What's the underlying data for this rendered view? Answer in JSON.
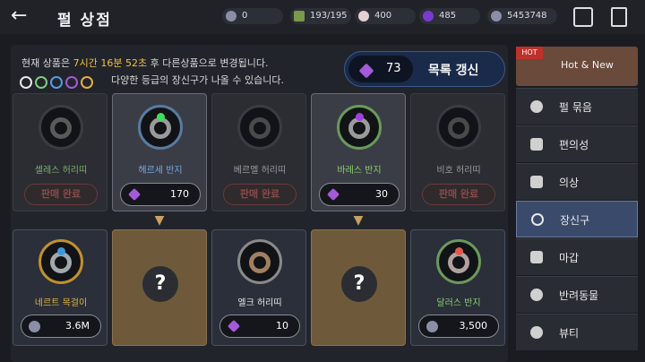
{
  "header": {
    "title": "펄 상점",
    "resources": [
      {
        "value": "0",
        "icon": "silver-coin-icon"
      },
      {
        "value": "193/195",
        "icon": "weight-icon"
      },
      {
        "value": "400",
        "icon": "pearl-icon"
      },
      {
        "value": "485",
        "icon": "gem-icon"
      },
      {
        "value": "5453748",
        "icon": "silver-icon"
      }
    ]
  },
  "notice": {
    "prefix": "현재 상품은",
    "time": "7시간 16분 52초",
    "suffix": "후 다른상품으로 변경됩니다.",
    "grades": "다양한 등급의 장신구가 나올 수 있습니다."
  },
  "refresh": {
    "count": "73",
    "label": "목록 갱신"
  },
  "top_cards": [
    {
      "name": "셀레스 허리띠",
      "name_color": "#7fae6e",
      "status": "판매 완료",
      "selected": false
    },
    {
      "name": "헤르세 반지",
      "name_color": "#7aa6e0",
      "price": "170",
      "selected": true
    },
    {
      "name": "베르멜 허리띠",
      "name_color": "#9a9a9a",
      "status": "판매 완료",
      "selected": false
    },
    {
      "name": "바레스 반지",
      "name_color": "#8ad06a",
      "price": "30",
      "selected": true
    },
    {
      "name": "비호 허리띠",
      "name_color": "#9a9a9a",
      "status": "판매 완료",
      "selected": false
    }
  ],
  "bottom_cards": [
    {
      "name": "네르트 목걸이",
      "name_color": "#e0b040",
      "price": "3.6M",
      "currency": "silver"
    },
    {
      "mystery": "?"
    },
    {
      "name": "엘크 허리띠",
      "name_color": "#e8e8e8",
      "price": "10",
      "currency": "gem"
    },
    {
      "mystery": "?"
    },
    {
      "name": "달러스 반지",
      "name_color": "#8ad06a",
      "price": "3,500",
      "currency": "silver"
    }
  ],
  "side_menu": {
    "hot": {
      "badge": "HOT",
      "label": "Hot & New"
    },
    "items": [
      {
        "label": "펄 묶음",
        "icon": "pearl-bundle-icon"
      },
      {
        "label": "편의성",
        "icon": "potion-icon"
      },
      {
        "label": "의상",
        "icon": "outfit-icon"
      },
      {
        "label": "장신구",
        "icon": "ring-icon",
        "active": true
      },
      {
        "label": "마갑",
        "icon": "horse-armor-icon"
      },
      {
        "label": "반려동물",
        "icon": "paw-icon"
      },
      {
        "label": "뷰티",
        "icon": "beauty-icon"
      }
    ]
  }
}
